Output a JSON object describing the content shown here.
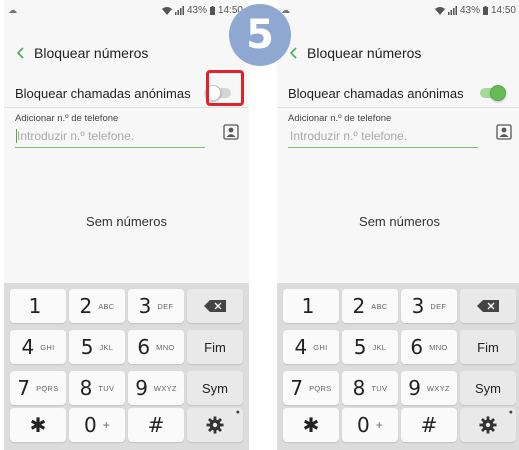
{
  "step_number": "5",
  "colors": {
    "accent_green": "#66bb55",
    "highlight_red": "#e0222a",
    "badge_blue": "#8ea8d1",
    "keypad_bg": "#dcdcdc"
  },
  "screens": [
    {
      "status": {
        "battery": "43%",
        "time": "14:50"
      },
      "title": "Bloquear números",
      "toggle": {
        "label": "Bloquear chamadas anónimas",
        "on": false
      },
      "field": {
        "label": "Adicionar n.º de telefone",
        "placeholder": "Introduzir n.º telefone."
      },
      "empty_text": "Sem números",
      "keypad": {
        "row1": [
          {
            "num": "1",
            "sub": ""
          },
          {
            "num": "2",
            "sub": "ABC"
          },
          {
            "num": "3",
            "sub": "DEF"
          }
        ],
        "row2": [
          {
            "num": "4",
            "sub": "GHI"
          },
          {
            "num": "5",
            "sub": "JKL"
          },
          {
            "num": "6",
            "sub": "MNO"
          }
        ],
        "row3": [
          {
            "num": "7",
            "sub": "PQRS"
          },
          {
            "num": "8",
            "sub": "TUV"
          },
          {
            "num": "9",
            "sub": "WXYZ"
          }
        ],
        "row4": [
          {
            "num": "✱",
            "sub": ""
          },
          {
            "num": "0",
            "sub": "+"
          },
          {
            "num": "#",
            "sub": ""
          }
        ],
        "fim": "Fim",
        "sym": "Sym"
      }
    },
    {
      "status": {
        "battery": "43%",
        "time": "14:50"
      },
      "title": "Bloquear números",
      "toggle": {
        "label": "Bloquear chamadas anónimas",
        "on": true
      },
      "field": {
        "label": "Adicionar n.º de telefone",
        "placeholder": "Introduzir n.º telefone."
      },
      "empty_text": "Sem números",
      "keypad": {
        "row1": [
          {
            "num": "1",
            "sub": ""
          },
          {
            "num": "2",
            "sub": "ABC"
          },
          {
            "num": "3",
            "sub": "DEF"
          }
        ],
        "row2": [
          {
            "num": "4",
            "sub": "GHI"
          },
          {
            "num": "5",
            "sub": "JKL"
          },
          {
            "num": "6",
            "sub": "MNO"
          }
        ],
        "row3": [
          {
            "num": "7",
            "sub": "PQRS"
          },
          {
            "num": "8",
            "sub": "TUV"
          },
          {
            "num": "9",
            "sub": "WXYZ"
          }
        ],
        "row4": [
          {
            "num": "✱",
            "sub": ""
          },
          {
            "num": "0",
            "sub": "+"
          },
          {
            "num": "#",
            "sub": ""
          }
        ],
        "fim": "Fim",
        "sym": "Sym"
      }
    }
  ]
}
